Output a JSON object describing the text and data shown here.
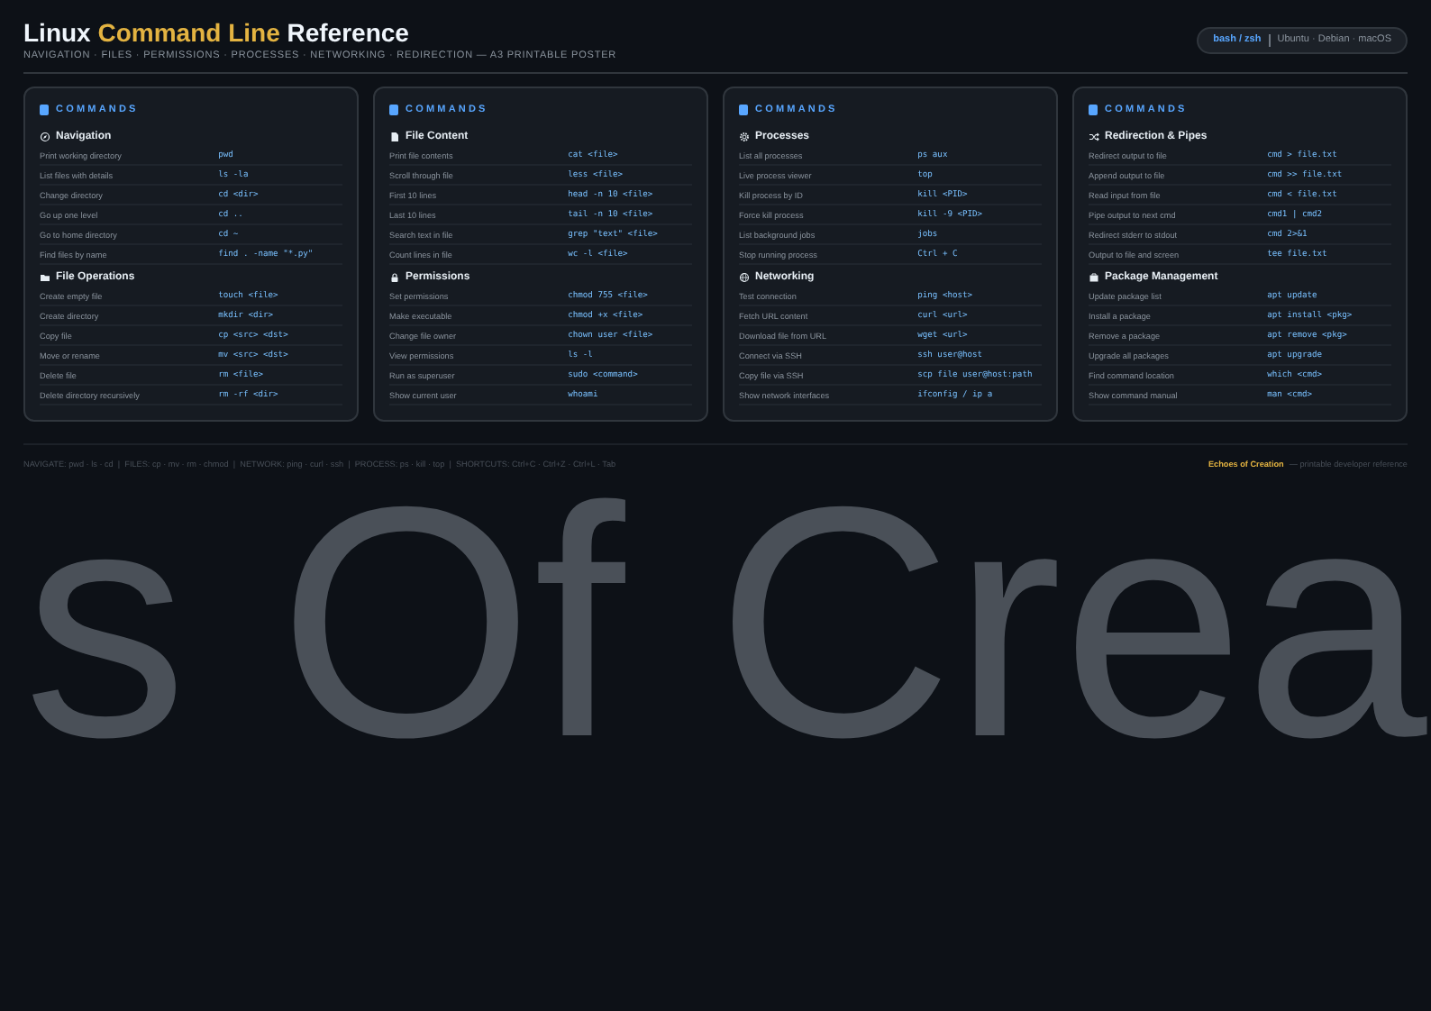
{
  "header": {
    "title_parts": [
      {
        "text": "Linux ",
        "accent": false
      },
      {
        "text": "Command Line",
        "accent": true
      },
      {
        "text": " Reference",
        "accent": false
      }
    ],
    "subtitle": "NAVIGATION · FILES · PERMISSIONS · PROCESSES · NETWORKING · REDIRECTION — A3 PRINTABLE POSTER",
    "shell_badge": {
      "shell": "bash / zsh",
      "systems": "Ubuntu · Debian · macOS"
    }
  },
  "cards": [
    {
      "heading": "COMMANDS",
      "sections": [
        {
          "kind": "navigation",
          "title": "Navigation",
          "rows": [
            {
              "label": "Print working directory",
              "command": "pwd"
            },
            {
              "label": "List files with details",
              "command": "ls -la"
            },
            {
              "label": "Change directory",
              "command": "cd <dir>"
            },
            {
              "label": "Go up one level",
              "command": "cd .."
            },
            {
              "label": "Go to home directory",
              "command": "cd ~"
            },
            {
              "label": "Find files by name",
              "command": "find . -name \"*.py\""
            }
          ]
        },
        {
          "kind": "folder",
          "title": "File Operations",
          "rows": [
            {
              "label": "Create empty file",
              "command": "touch <file>"
            },
            {
              "label": "Create directory",
              "command": "mkdir <dir>"
            },
            {
              "label": "Copy file",
              "command": "cp <src> <dst>"
            },
            {
              "label": "Move or rename",
              "command": "mv <src> <dst>"
            },
            {
              "label": "Delete file",
              "command": "rm <file>"
            },
            {
              "label": "Delete directory recursively",
              "command": "rm -rf <dir>"
            }
          ]
        }
      ]
    },
    {
      "heading": "COMMANDS",
      "sections": [
        {
          "kind": "document",
          "title": "File Content",
          "rows": [
            {
              "label": "Print file contents",
              "command": "cat <file>"
            },
            {
              "label": "Scroll through file",
              "command": "less <file>"
            },
            {
              "label": "First 10 lines",
              "command": "head -n 10 <file>"
            },
            {
              "label": "Last 10 lines",
              "command": "tail -n 10 <file>"
            },
            {
              "label": "Search text in file",
              "command": "grep \"text\" <file>"
            },
            {
              "label": "Count lines in file",
              "command": "wc -l <file>"
            }
          ]
        },
        {
          "kind": "lock",
          "title": "Permissions",
          "rows": [
            {
              "label": "Set permissions",
              "command": "chmod 755 <file>"
            },
            {
              "label": "Make executable",
              "command": "chmod +x <file>"
            },
            {
              "label": "Change file owner",
              "command": "chown user <file>"
            },
            {
              "label": "View permissions",
              "command": "ls -l"
            },
            {
              "label": "Run as superuser",
              "command": "sudo <command>"
            },
            {
              "label": "Show current user",
              "command": "whoami"
            }
          ]
        }
      ]
    },
    {
      "heading": "COMMANDS",
      "sections": [
        {
          "kind": "gear",
          "title": "Processes",
          "rows": [
            {
              "label": "List all processes",
              "command": "ps aux"
            },
            {
              "label": "Live process viewer",
              "command": "top"
            },
            {
              "label": "Kill process by ID",
              "command": "kill <PID>"
            },
            {
              "label": "Force kill process",
              "command": "kill -9 <PID>"
            },
            {
              "label": "List background jobs",
              "command": "jobs"
            },
            {
              "label": "Stop running process",
              "command": "Ctrl + C"
            }
          ]
        },
        {
          "kind": "globe",
          "title": "Networking",
          "rows": [
            {
              "label": "Test connection",
              "command": "ping <host>"
            },
            {
              "label": "Fetch URL content",
              "command": "curl <url>"
            },
            {
              "label": "Download file from URL",
              "command": "wget <url>"
            },
            {
              "label": "Connect via SSH",
              "command": "ssh user@host"
            },
            {
              "label": "Copy file via SSH",
              "command": "scp file user@host:path"
            },
            {
              "label": "Show network interfaces",
              "command": "ifconfig / ip a"
            }
          ]
        }
      ]
    },
    {
      "heading": "COMMANDS",
      "sections": [
        {
          "kind": "shuffle",
          "title": "Redirection & Pipes",
          "rows": [
            {
              "label": "Redirect output to file",
              "command": "cmd > file.txt"
            },
            {
              "label": "Append output to file",
              "command": "cmd >> file.txt"
            },
            {
              "label": "Read input from file",
              "command": "cmd < file.txt"
            },
            {
              "label": "Pipe output to next cmd",
              "command": "cmd1 | cmd2"
            },
            {
              "label": "Redirect stderr to stdout",
              "command": "cmd 2>&1"
            },
            {
              "label": "Output to file and screen",
              "command": "tee file.txt"
            }
          ]
        },
        {
          "kind": "package",
          "title": "Package Management",
          "rows": [
            {
              "label": "Update package list",
              "command": "apt update"
            },
            {
              "label": "Install a package",
              "command": "apt install <pkg>"
            },
            {
              "label": "Remove a package",
              "command": "apt remove <pkg>"
            },
            {
              "label": "Upgrade all packages",
              "command": "apt upgrade"
            },
            {
              "label": "Find command location",
              "command": "which <cmd>"
            },
            {
              "label": "Show command manual",
              "command": "man <cmd>"
            }
          ]
        }
      ]
    }
  ],
  "footer": {
    "summary": "NAVIGATE: pwd · ls · cd  |  FILES: cp · mv · rm · chmod  |  NETWORK: ping · curl · ssh  |  PROCESS: ps · kill · top  |  SHORTCUTS: Ctrl+C · Ctrl+Z · Ctrl+L · Tab",
    "brand": "Echoes of Creation",
    "tagline": "— printable developer reference"
  },
  "backdrop_text": "s Of Crea"
}
